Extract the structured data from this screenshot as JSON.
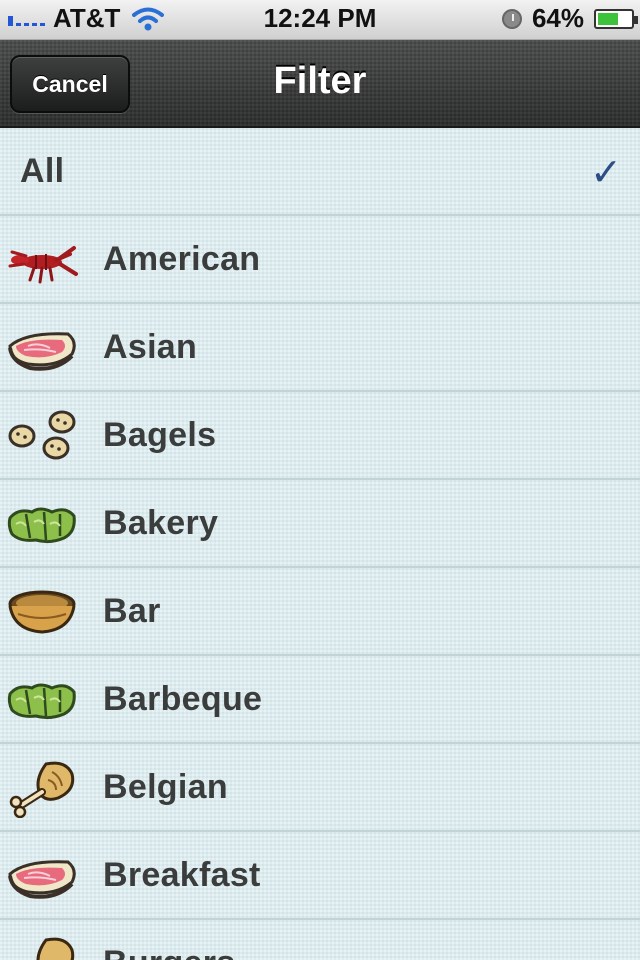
{
  "status_bar": {
    "carrier": "AT&T",
    "time": "12:24 PM",
    "battery_percent": "64%",
    "battery_level": 0.64
  },
  "nav": {
    "title": "Filter",
    "cancel_label": "Cancel"
  },
  "list": {
    "selected": "All",
    "items": [
      {
        "label": "All",
        "icon": null,
        "checked": true
      },
      {
        "label": "American",
        "icon": "lobster-icon"
      },
      {
        "label": "Asian",
        "icon": "steak-icon"
      },
      {
        "label": "Bagels",
        "icon": "bagels-icon"
      },
      {
        "label": "Bakery",
        "icon": "lettuce-wrap-icon"
      },
      {
        "label": "Bar",
        "icon": "bowl-icon"
      },
      {
        "label": "Barbeque",
        "icon": "lettuce-wrap-icon"
      },
      {
        "label": "Belgian",
        "icon": "drumstick-icon"
      },
      {
        "label": "Breakfast",
        "icon": "steak-icon"
      },
      {
        "label": "Burgers",
        "icon": "drumstick-icon"
      }
    ]
  },
  "colors": {
    "nav_background": "#2f3130",
    "list_background": "#dcebef",
    "row_text": "#3a3d3c",
    "checkmark": "#2d4e85",
    "separator": "#c3d4d9"
  }
}
